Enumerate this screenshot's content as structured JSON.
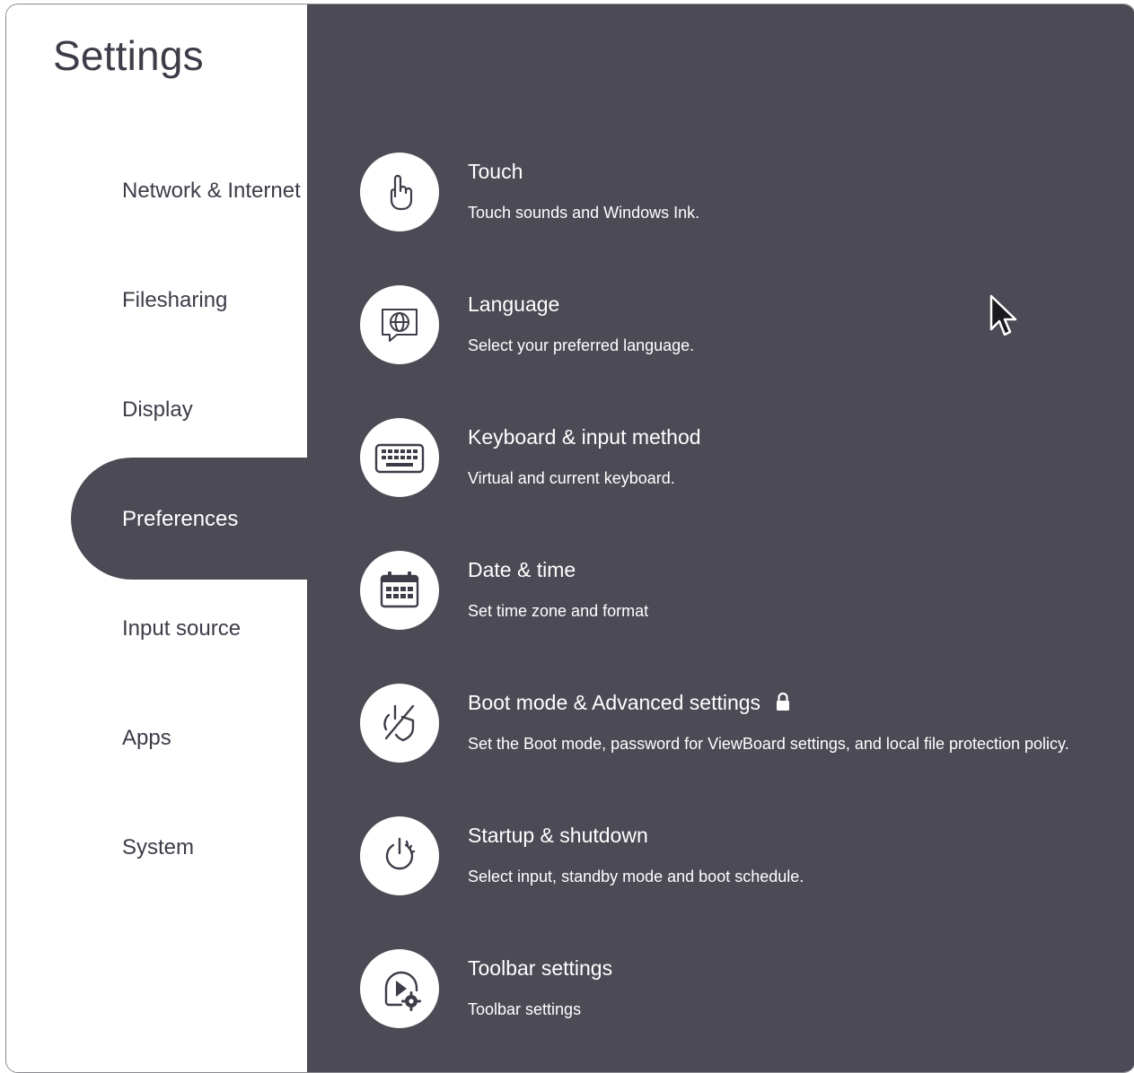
{
  "app": {
    "title": "Settings"
  },
  "sidebar": {
    "items": [
      {
        "label": "Network & Internet",
        "active": false
      },
      {
        "label": "Filesharing",
        "active": false
      },
      {
        "label": "Display",
        "active": false
      },
      {
        "label": "Preferences",
        "active": true
      },
      {
        "label": "Input source",
        "active": false
      },
      {
        "label": "Apps",
        "active": false
      },
      {
        "label": "System",
        "active": false
      }
    ]
  },
  "main": {
    "rows": [
      {
        "title": "Touch",
        "description": "Touch sounds and Windows Ink.",
        "icon": "touch-hand-icon"
      },
      {
        "title": "Language",
        "description": "Select your preferred language.",
        "icon": "globe-speech-icon"
      },
      {
        "title": "Keyboard & input method",
        "description": "Virtual and current keyboard.",
        "icon": "keyboard-icon"
      },
      {
        "title": "Date & time",
        "description": "Set time zone and format",
        "icon": "calendar-icon"
      },
      {
        "title": "Boot mode & Advanced settings",
        "description": "Set the Boot mode, password for ViewBoard settings, and local file protection policy.",
        "icon": "power-shield-icon",
        "locked": true
      },
      {
        "title": "Startup & shutdown",
        "description": "Select input, standby mode and boot schedule.",
        "icon": "power-icon"
      },
      {
        "title": "Toolbar settings",
        "description": "Toolbar settings",
        "icon": "toolbar-play-gear-icon"
      }
    ]
  },
  "colors": {
    "panel": "#4b4a55",
    "text_dark": "#3d3c48",
    "text_light": "#ffffff"
  }
}
